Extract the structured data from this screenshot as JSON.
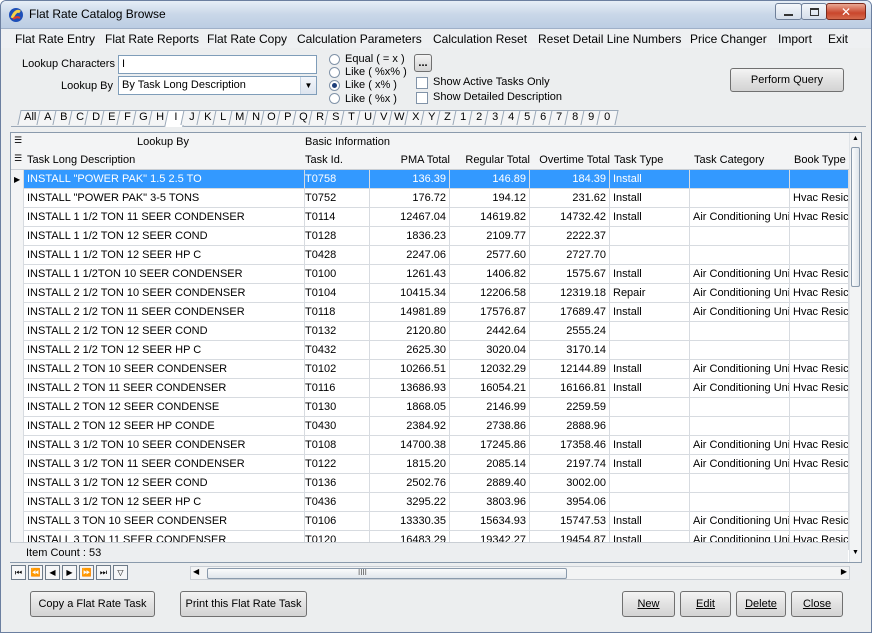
{
  "window": {
    "title": "Flat Rate Catalog Browse"
  },
  "menu": [
    "Flat Rate Entry",
    "Flat Rate Reports",
    "Flat Rate Copy",
    "Calculation Parameters",
    "Calculation Reset",
    "Reset Detail Line Numbers",
    "Price Changer",
    "Import",
    "Exit"
  ],
  "lookup": {
    "chars_label": "Lookup Characters",
    "chars_value": "I",
    "by_label": "Lookup By",
    "by_value": "By Task Long Description",
    "ellipsis": "...",
    "radios": [
      "Equal ( = x )",
      "Like ( %x% )",
      "Like ( x% )",
      "Like ( %x )"
    ],
    "radio_selected": 2,
    "checks": [
      "Show Active Tasks Only",
      "Show Detailed Description"
    ],
    "perform_btn": "Perform Query"
  },
  "alpha_tabs": [
    "All",
    "A",
    "B",
    "C",
    "D",
    "E",
    "F",
    "G",
    "H",
    "I",
    "J",
    "K",
    "L",
    "M",
    "N",
    "O",
    "P",
    "Q",
    "R",
    "S",
    "T",
    "U",
    "V",
    "W",
    "X",
    "Y",
    "Z",
    "1",
    "2",
    "3",
    "4",
    "5",
    "6",
    "7",
    "8",
    "9",
    "0"
  ],
  "alpha_selected": "I",
  "grid": {
    "band_headers": [
      "Lookup By",
      "Basic Information"
    ],
    "columns": [
      "Task Long Description",
      "Task Id.",
      "PMA Total",
      "Regular Total",
      "Overtime Total",
      "Task Type",
      "Task Category",
      "Book Type"
    ],
    "rows": [
      [
        "INSTALL \"POWER PAK\" 1.5 2.5 TO",
        "T0758",
        "136.39",
        "146.89",
        "184.39",
        "Install",
        "",
        ""
      ],
      [
        "INSTALL \"POWER PAK\" 3-5 TONS",
        "T0752",
        "176.72",
        "194.12",
        "231.62",
        "Install",
        "",
        "Hvac Resic"
      ],
      [
        "INSTALL 1 1/2 TON 11 SEER CONDENSER",
        "T0114",
        "12467.04",
        "14619.82",
        "14732.42",
        "Install",
        "Air Conditioning Unit",
        "Hvac Resic"
      ],
      [
        "INSTALL 1 1/2 TON 12 SEER COND",
        "T0128",
        "1836.23",
        "2109.77",
        "2222.37",
        "",
        "",
        ""
      ],
      [
        "INSTALL 1 1/2 TON 12 SEER HP C",
        "T0428",
        "2247.06",
        "2577.60",
        "2727.70",
        "",
        "",
        ""
      ],
      [
        "INSTALL 1 1/2TON 10 SEER CONDENSER",
        "T0100",
        "1261.43",
        "1406.82",
        "1575.67",
        "Install",
        "Air Conditioning Unit",
        "Hvac Resic"
      ],
      [
        "INSTALL 2 1/2 TON 10 SEER CONDENSER",
        "T0104",
        "10415.34",
        "12206.58",
        "12319.18",
        "Repair",
        "Air Conditioning Unit",
        "Hvac Resic"
      ],
      [
        "INSTALL 2 1/2 TON 11 SEER CONDENSER",
        "T0118",
        "14981.89",
        "17576.87",
        "17689.47",
        "Install",
        "Air Conditioning Unit",
        "Hvac Resic"
      ],
      [
        "INSTALL 2 1/2 TON 12 SEER COND",
        "T0132",
        "2120.80",
        "2442.64",
        "2555.24",
        "",
        "",
        ""
      ],
      [
        "INSTALL 2 1/2 TON 12 SEER HP C",
        "T0432",
        "2625.30",
        "3020.04",
        "3170.14",
        "",
        "",
        ""
      ],
      [
        "INSTALL 2 TON 10 SEER CONDENSER",
        "T0102",
        "10266.51",
        "12032.29",
        "12144.89",
        "Install",
        "Air Conditioning Unit",
        "Hvac Resic"
      ],
      [
        "INSTALL 2 TON 11 SEER CONDENSER",
        "T0116",
        "13686.93",
        "16054.21",
        "16166.81",
        "Install",
        "Air Conditioning Unit",
        "Hvac Resic"
      ],
      [
        "INSTALL 2 TON 12 SEER CONDENSE",
        "T0130",
        "1868.05",
        "2146.99",
        "2259.59",
        "",
        "",
        ""
      ],
      [
        "INSTALL 2 TON 12 SEER HP CONDE",
        "T0430",
        "2384.92",
        "2738.86",
        "2888.96",
        "",
        "",
        ""
      ],
      [
        "INSTALL 3 1/2 TON 10 SEER CONDENSER",
        "T0108",
        "14700.38",
        "17245.86",
        "17358.46",
        "Install",
        "Air Conditioning Unit",
        "Hvac Resic"
      ],
      [
        "INSTALL 3 1/2 TON 11 SEER CONDENSER",
        "T0122",
        "1815.20",
        "2085.14",
        "2197.74",
        "Install",
        "Air Conditioning Unit",
        "Hvac Resic"
      ],
      [
        "INSTALL 3 1/2 TON 12 SEER COND",
        "T0136",
        "2502.76",
        "2889.40",
        "3002.00",
        "",
        "",
        ""
      ],
      [
        "INSTALL 3 1/2 TON 12 SEER HP C",
        "T0436",
        "3295.22",
        "3803.96",
        "3954.06",
        "",
        "",
        ""
      ],
      [
        "INSTALL 3 TON 10 SEER CONDENSER",
        "T0106",
        "13330.35",
        "15634.93",
        "15747.53",
        "Install",
        "Air Conditioning Unit",
        "Hvac Resic"
      ],
      [
        "INSTALL 3 TON 11 SEER CONDENSER",
        "T0120",
        "16483.29",
        "19342.27",
        "19454.87",
        "Install",
        "Air Conditioning Unit",
        "Hvac Resic"
      ]
    ],
    "selected_row": 0,
    "item_count": "Item Count : 53",
    "hscroll_label": "IIII"
  },
  "buttons": {
    "copy": "Copy a Flat Rate Task",
    "print": "Print this Flat Rate Task",
    "new": "New",
    "edit": "Edit",
    "delete": "Delete",
    "close": "Close"
  }
}
